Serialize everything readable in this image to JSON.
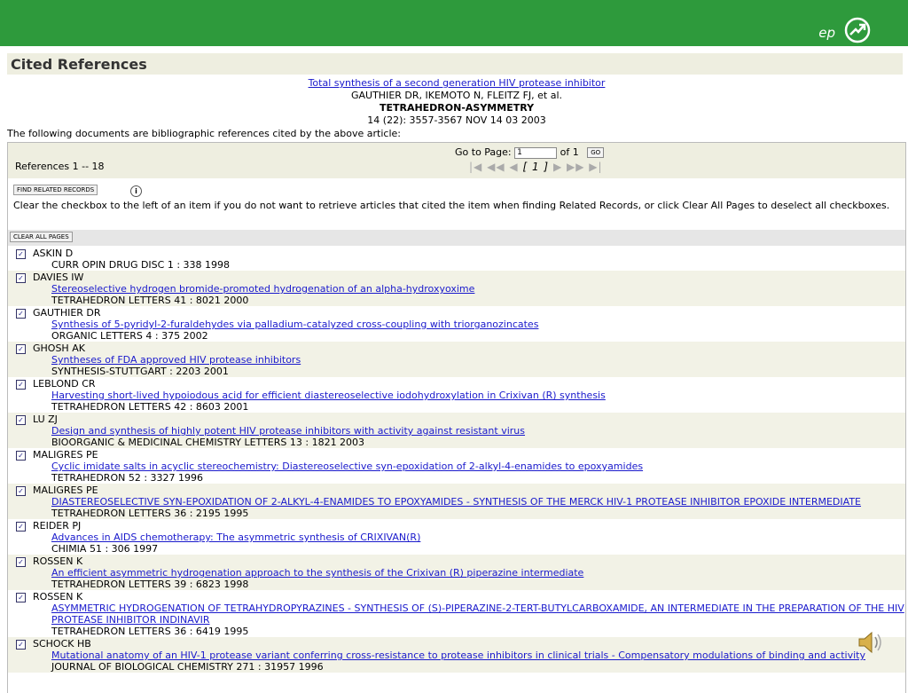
{
  "header": {
    "logo_text": "ep",
    "logo_icon": "arrow-circle-icon"
  },
  "section_title": "Cited References",
  "article": {
    "title": "Total synthesis of a second generation HIV protease inhibitor",
    "authors": "GAUTHIER DR, IKEMOTO N, FLEITZ FJ, et al.",
    "journal": "TETRAHEDRON-ASYMMETRY",
    "citation": "14 (22): 3557-3567 NOV 14 03 2003"
  },
  "intro_text": "The following documents are bibliographic references cited by the above article:",
  "pager": {
    "references_label": "References 1 -- 18",
    "goto_label": "Go to Page:",
    "page_value": "1",
    "of_label": "of 1",
    "go_button": "GO",
    "page_indicator": "[ 1 ]"
  },
  "buttons": {
    "find_related": "FIND RELATED RECORDS",
    "clear_all": "CLEAR ALL PAGES"
  },
  "instructions": "Clear the checkbox to the left of an item if you do not want to retrieve articles that cited the item when finding Related Records, or click Clear All Pages to deselect all checkboxes.",
  "references": [
    {
      "author": "ASKIN D",
      "title": "",
      "source": "CURR OPIN DRUG DISC 1 : 338 1998"
    },
    {
      "author": "DAVIES IW",
      "title": "Stereoselective hydrogen bromide-promoted hydrogenation of an alpha-hydroxyoxime",
      "source": "TETRAHEDRON LETTERS 41 : 8021 2000"
    },
    {
      "author": "GAUTHIER DR",
      "title": "Synthesis of 5-pyridyl-2-furaldehydes via palladium-catalyzed cross-coupling with triorganozincates",
      "source": "ORGANIC LETTERS 4 : 375 2002"
    },
    {
      "author": "GHOSH AK",
      "title": "Syntheses of FDA approved HIV protease inhibitors",
      "source": "SYNTHESIS-STUTTGART : 2203 2001"
    },
    {
      "author": "LEBLOND CR",
      "title": "Harvesting short-lived hypoiodous acid for efficient diastereoselective iodohydroxylation in Crixivan (R) synthesis",
      "source": "TETRAHEDRON LETTERS 42 : 8603 2001"
    },
    {
      "author": "LU ZJ",
      "title": "Design and synthesis of highly potent HIV protease inhibitors with activity against resistant virus",
      "source": "BIOORGANIC & MEDICINAL CHEMISTRY LETTERS 13 : 1821 2003"
    },
    {
      "author": "MALIGRES PE",
      "title": "Cyclic imidate salts in acyclic stereochemistry: Diastereoselective syn-epoxidation of 2-alkyl-4-enamides to epoxyamides",
      "source": "TETRAHEDRON 52 : 3327 1996"
    },
    {
      "author": "MALIGRES PE",
      "title": "DIASTEREOSELECTIVE SYN-EPOXIDATION OF 2-ALKYL-4-ENAMIDES TO EPOXYAMIDES - SYNTHESIS OF THE MERCK HIV-1 PROTEASE INHIBITOR EPOXIDE INTERMEDIATE",
      "source": "TETRAHEDRON LETTERS 36 : 2195 1995"
    },
    {
      "author": "REIDER PJ",
      "title": "Advances in AIDS chemotherapy: The asymmetric synthesis of CRIXIVAN(R)",
      "source": "CHIMIA 51 : 306 1997"
    },
    {
      "author": "ROSSEN K",
      "title": "An efficient asymmetric hydrogenation approach to the synthesis of the Crixivan (R) piperazine intermediate",
      "source": "TETRAHEDRON LETTERS 39 : 6823 1998"
    },
    {
      "author": "ROSSEN K",
      "title": "ASYMMETRIC HYDROGENATION OF TETRAHYDROPYRAZINES - SYNTHESIS OF (S)-PIPERAZINE-2-TERT-BUTYLCARBOXAMIDE, AN INTERMEDIATE IN THE PREPARATION OF THE HIV PROTEASE INHIBITOR INDINAVIR",
      "source": "TETRAHEDRON LETTERS 36 : 6419 1995"
    },
    {
      "author": "SCHOCK HB",
      "title": "Mutational anatomy of an HIV-1 protease variant conferring cross-resistance to protease inhibitors in clinical trials - Compensatory modulations of binding and activity",
      "source": "JOURNAL OF BIOLOGICAL CHEMISTRY 271 : 31957 1996"
    }
  ],
  "colors": {
    "topbar": "#2e9a3c",
    "link": "#1a1acc",
    "band": "#eeeee0"
  }
}
